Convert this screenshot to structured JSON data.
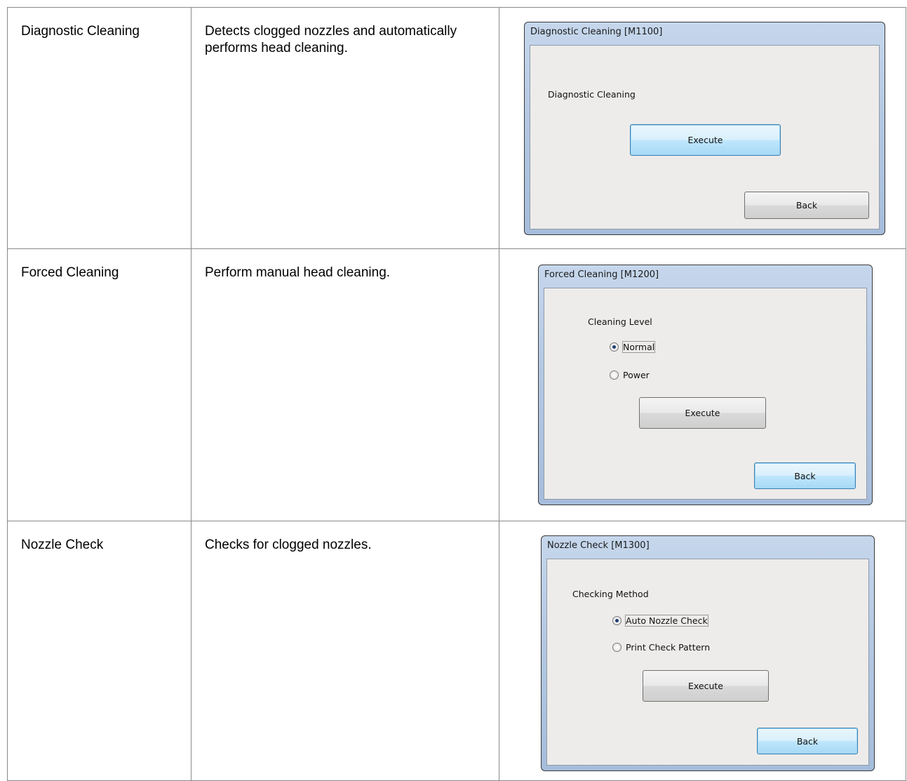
{
  "rows": [
    {
      "name": "Diagnostic Cleaning",
      "description": "Detects clogged nozzles and automatically performs head cleaning.",
      "dialog": {
        "title": "Diagnostic Cleaning [M1100]",
        "label": "Diagnostic Cleaning",
        "execute": "Execute",
        "back": "Back"
      }
    },
    {
      "name": "Forced Cleaning",
      "description": "Perform manual head cleaning.",
      "dialog": {
        "title": "Forced Cleaning [M1200]",
        "group_label": "Cleaning Level",
        "options": [
          "Normal",
          "Power"
        ],
        "selected": "Normal",
        "execute": "Execute",
        "back": "Back"
      }
    },
    {
      "name": "Nozzle Check",
      "description": "Checks for clogged nozzles.",
      "dialog": {
        "title": "Nozzle Check [M1300]",
        "group_label": "Checking Method",
        "options": [
          "Auto Nozzle Check",
          "Print Check Pattern"
        ],
        "selected": "Auto Nozzle Check",
        "execute": "Execute",
        "back": "Back"
      }
    }
  ]
}
